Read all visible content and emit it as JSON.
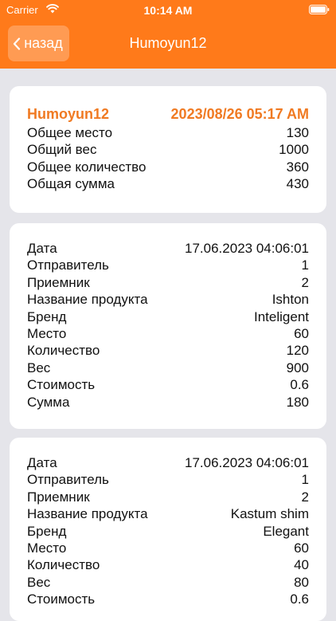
{
  "status_bar": {
    "carrier": "Carrier",
    "time": "10:14 AM"
  },
  "nav": {
    "back_label": "назад",
    "title": "Humoyun12"
  },
  "summary": {
    "user": "Humoyun12",
    "datetime": "2023/08/26 05:17 AM",
    "rows": [
      {
        "label": "Общее место",
        "value": "130"
      },
      {
        "label": "Общий вес",
        "value": "1000"
      },
      {
        "label": "Общее количество",
        "value": "360"
      },
      {
        "label": "Общая сумма",
        "value": "430"
      }
    ]
  },
  "items": [
    {
      "rows": [
        {
          "label": "Дата",
          "value": "17.06.2023 04:06:01"
        },
        {
          "label": "Отправитель",
          "value": "1"
        },
        {
          "label": "Приемник",
          "value": "2"
        },
        {
          "label": "Название продукта",
          "value": "Ishton"
        },
        {
          "label": "Бренд",
          "value": "Inteligent"
        },
        {
          "label": "Место",
          "value": "60"
        },
        {
          "label": "Количество",
          "value": "120"
        },
        {
          "label": "Вес",
          "value": "900"
        },
        {
          "label": "Стоимость",
          "value": "0.6"
        },
        {
          "label": "Сумма",
          "value": "180"
        }
      ]
    },
    {
      "rows": [
        {
          "label": "Дата",
          "value": "17.06.2023 04:06:01"
        },
        {
          "label": "Отправитель",
          "value": "1"
        },
        {
          "label": "Приемник",
          "value": "2"
        },
        {
          "label": "Название продукта",
          "value": "Kastum shim"
        },
        {
          "label": "Бренд",
          "value": "Elegant"
        },
        {
          "label": "Место",
          "value": "60"
        },
        {
          "label": "Количество",
          "value": "40"
        },
        {
          "label": "Вес",
          "value": "80"
        },
        {
          "label": "Стоимость",
          "value": "0.6"
        }
      ]
    }
  ],
  "colors": {
    "accent": "#ff7a1a",
    "summary_text": "#f07a22",
    "background": "#e5e5ea",
    "card": "#ffffff"
  },
  "icons": [
    "wifi-icon",
    "battery-icon",
    "chevron-left-icon"
  ]
}
